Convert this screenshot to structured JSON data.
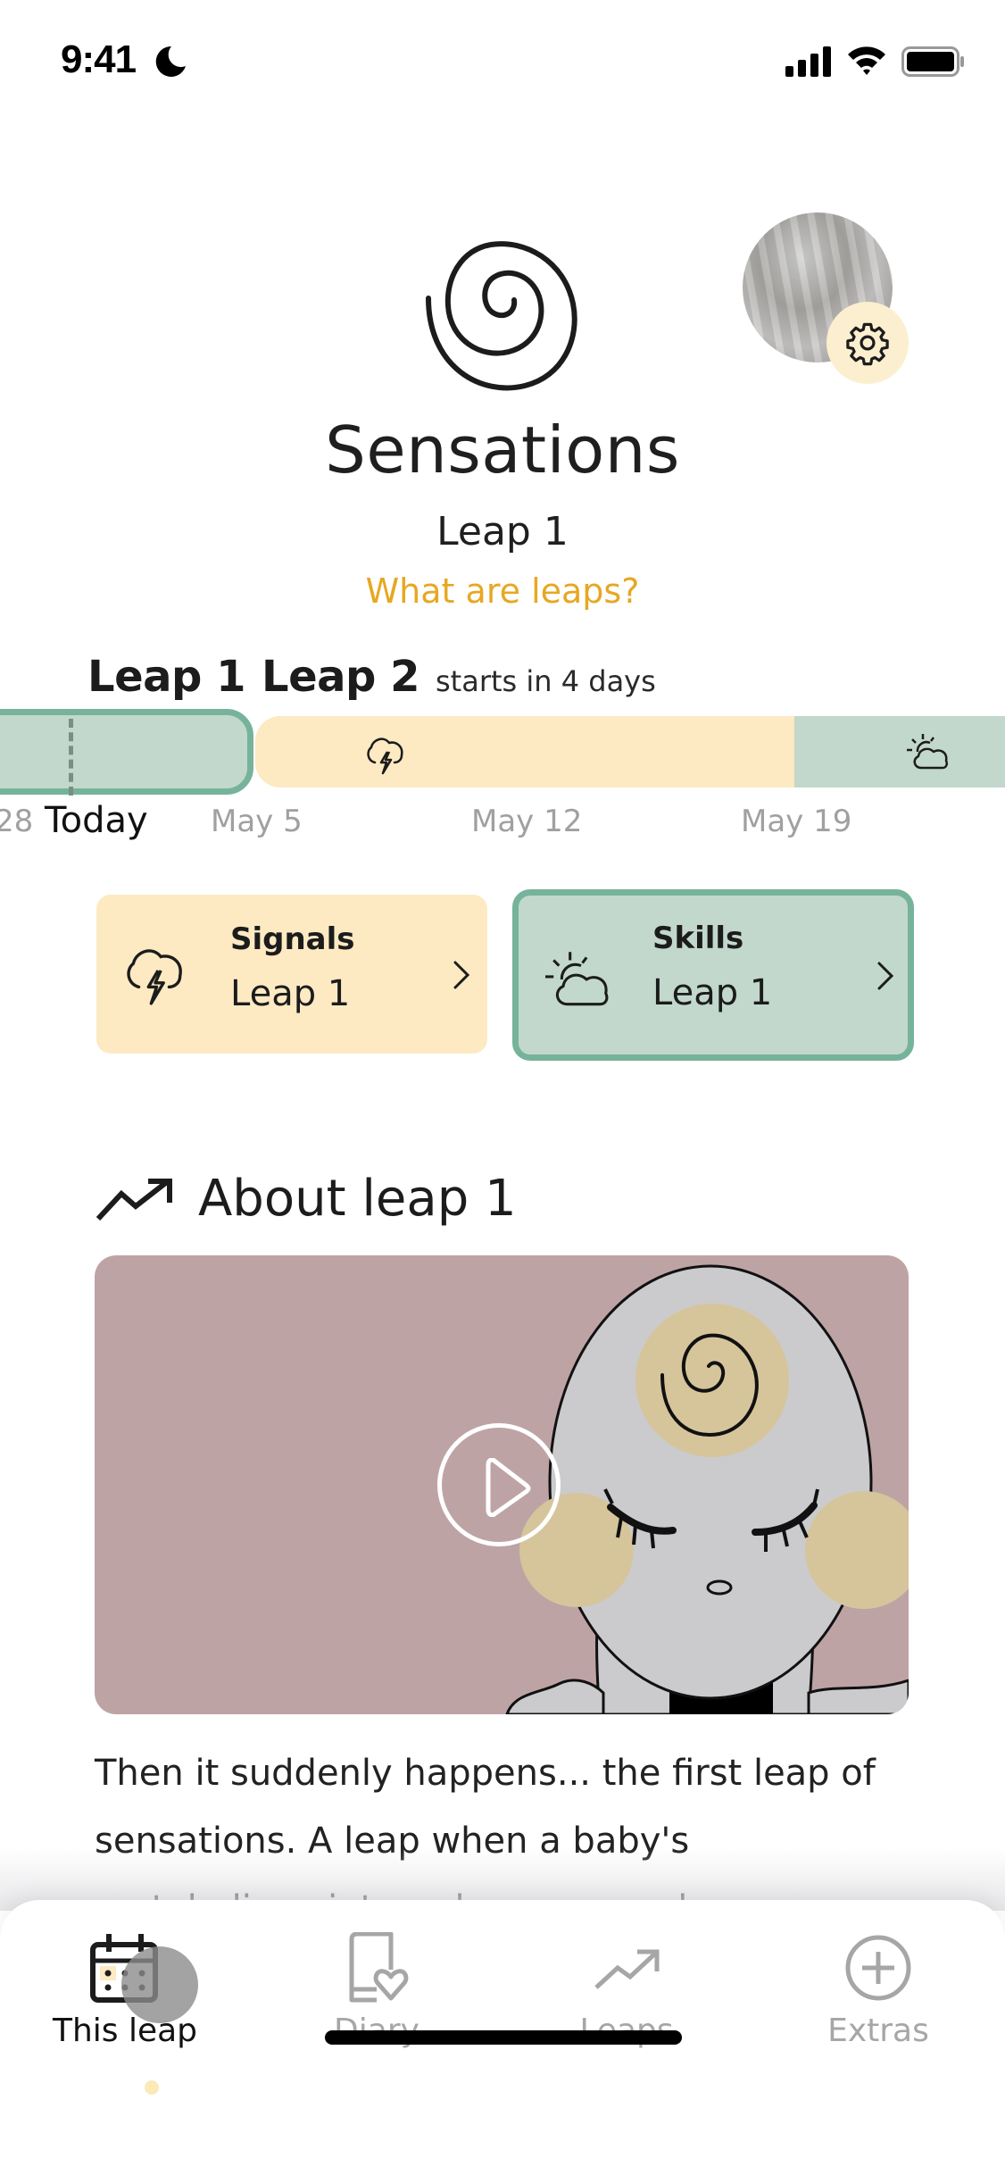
{
  "status_bar": {
    "time": "9:41",
    "icons": [
      "moon-icon",
      "signal-icon",
      "wifi-icon",
      "battery-icon"
    ]
  },
  "header": {
    "leap_icon": "spiral-icon",
    "title": "Sensations",
    "subtitle": "Leap 1",
    "link": "What are leaps?",
    "settings_icon": "gear-icon",
    "avatar": "avatar-photo"
  },
  "timeline": {
    "current_leap": "Leap 1",
    "next_leap": "Leap 2",
    "next_note": "starts in 4 days",
    "labels": {
      "left_partial": "28",
      "today": "Today",
      "may5": "May 5",
      "may12": "May 12",
      "may19": "May 19"
    },
    "segments": [
      {
        "type": "current",
        "color": "#c2d8cd",
        "border": "#76b39a"
      },
      {
        "type": "signals",
        "icon": "storm-cloud-icon",
        "color": "#fde9c2"
      },
      {
        "type": "skills",
        "icon": "sun-cloud-icon",
        "color": "#c2d8cd"
      }
    ]
  },
  "cards": [
    {
      "title": "Signals",
      "subtitle": "Leap 1",
      "icon": "storm-cloud-icon",
      "color": "#fdeac3"
    },
    {
      "title": "Skills",
      "subtitle": "Leap 1",
      "icon": "sun-cloud-icon",
      "color": "#c2d8cd",
      "selected": true
    }
  ],
  "about": {
    "title": "About leap 1",
    "icon": "trend-up-icon",
    "video_play_icon": "play-icon",
    "text": "Then it suddenly happens... the first leap of sensations. A leap when a baby's metabolism, internal organs, and senses"
  },
  "tab_bar": {
    "tabs": [
      {
        "label": "This leap",
        "icon": "calendar-icon",
        "active": true
      },
      {
        "label": "Diary",
        "icon": "diary-heart-icon",
        "active": false
      },
      {
        "label": "Leaps",
        "icon": "trend-up-icon",
        "active": false
      },
      {
        "label": "Extras",
        "icon": "plus-circle-icon",
        "active": false
      }
    ]
  },
  "colors": {
    "accent_link": "#e6a823",
    "signals_yellow": "#fdeac3",
    "skills_green": "#c2d8cd",
    "skills_border": "#76b39a",
    "video_bg": "#bea3a5"
  }
}
